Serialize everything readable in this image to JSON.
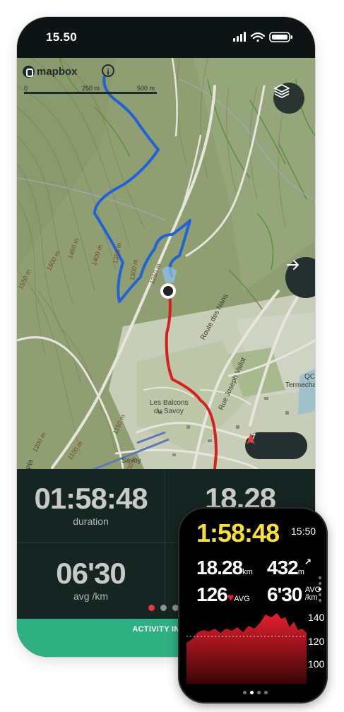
{
  "status_bar": {
    "time": "15.50"
  },
  "map": {
    "brand": "mapbox",
    "info_symbol": "i",
    "scale": {
      "ticks": [
        "0",
        "250 m",
        "500 m"
      ]
    },
    "labels": {
      "balcons": "Les Balcons",
      "savoy_line2": "du Savoy",
      "savoy": "Savoy",
      "route_nans": "Route des Nans",
      "rue_vallot": "Rue Joseph Vallot",
      "termech": "Termecha",
      "qc": "QC",
      "ro": "Ro",
      "pla": "Pla"
    },
    "contours": [
      "1500 m",
      "1450 m",
      "1400 m",
      "1350 m",
      "1300 m",
      "1250 m",
      "1550 m",
      "1200 m",
      "1100 m",
      "1150 m",
      "1100 m",
      "1200 m"
    ],
    "buttons": {
      "layers": "layers-icon",
      "next": "arrow-right-icon",
      "locate": "navigation-arrow-icon",
      "compass": "compass-north-icon"
    }
  },
  "stats": {
    "duration": {
      "value": "01:58:48",
      "label": "duration"
    },
    "distance": {
      "value": "18.28"
    },
    "pace": {
      "value": "06'30",
      "label": "avg /km"
    },
    "page_dots": 3,
    "activity_label": "ACTIVITY IN PRO"
  },
  "watch": {
    "duration": "1:58:48",
    "clock": "15:50",
    "distance": {
      "value": "18.28",
      "unit": "km"
    },
    "ascent": {
      "value": "432",
      "unit": "m"
    },
    "heart_rate": {
      "value": "126",
      "unit": "AVG"
    },
    "pace": {
      "value": "6'30",
      "unit_top": "AVG",
      "unit_bottom": "/km"
    },
    "chart_axis": [
      "140",
      "120",
      "100"
    ],
    "colors": {
      "duration": "#f7e03a",
      "heart": "#e5202e"
    }
  },
  "colors": {
    "track_blue": "#1f63d8",
    "track_red": "#d61f1f",
    "accent_green": "#2fb083",
    "panel": "#152521"
  }
}
